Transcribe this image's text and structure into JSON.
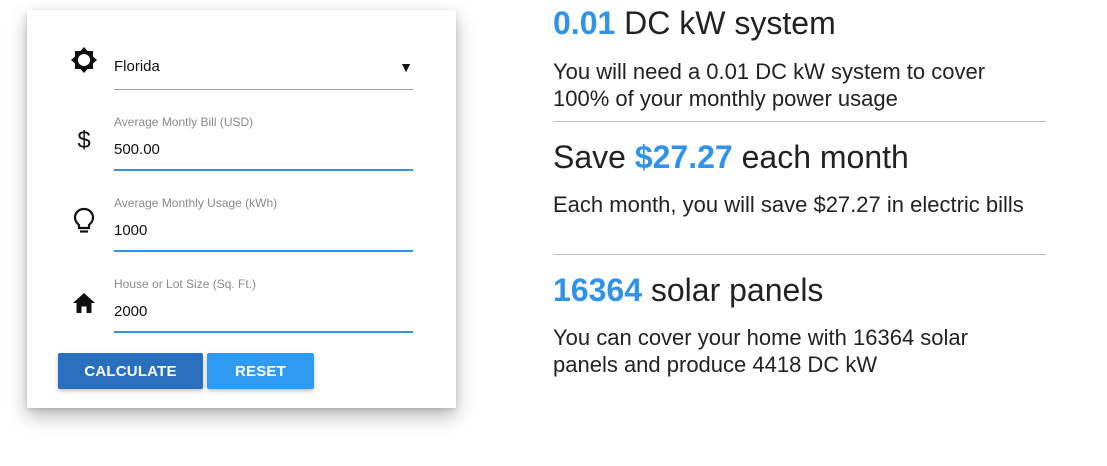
{
  "form": {
    "location": {
      "value": "Florida",
      "icon": "sun-icon",
      "arrow": "▼"
    },
    "bill": {
      "label": "Average Montly Bill (USD)",
      "value": "500.00",
      "icon": "dollar-icon"
    },
    "usage": {
      "label": "Average Monthly Usage (kWh)",
      "value": "1000",
      "icon": "lightbulb-icon"
    },
    "size": {
      "label": "House or Lot Size (Sq. Ft.)",
      "value": "2000",
      "icon": "home-icon"
    },
    "calculate_label": "CALCULATE",
    "reset_label": "RESET"
  },
  "results": {
    "system": {
      "value": "0.01",
      "title_suffix": " DC kW system",
      "description": "You will need a 0.01 DC kW system to cover 100% of your monthly power usage"
    },
    "savings": {
      "prefix": "Save ",
      "value": "$27.27",
      "title_suffix": " each month",
      "description": "Each month, you will save $27.27 in electric bills"
    },
    "panels": {
      "value": "16364",
      "title_suffix": " solar panels",
      "description": "You can cover your home with 16364 solar panels and produce 4418 DC kW"
    }
  },
  "colors": {
    "accent": "#2f93ea",
    "calculate_button": "#2a6fbd",
    "reset_button": "#2f9bf0",
    "underline_active": "#2f93ea"
  }
}
